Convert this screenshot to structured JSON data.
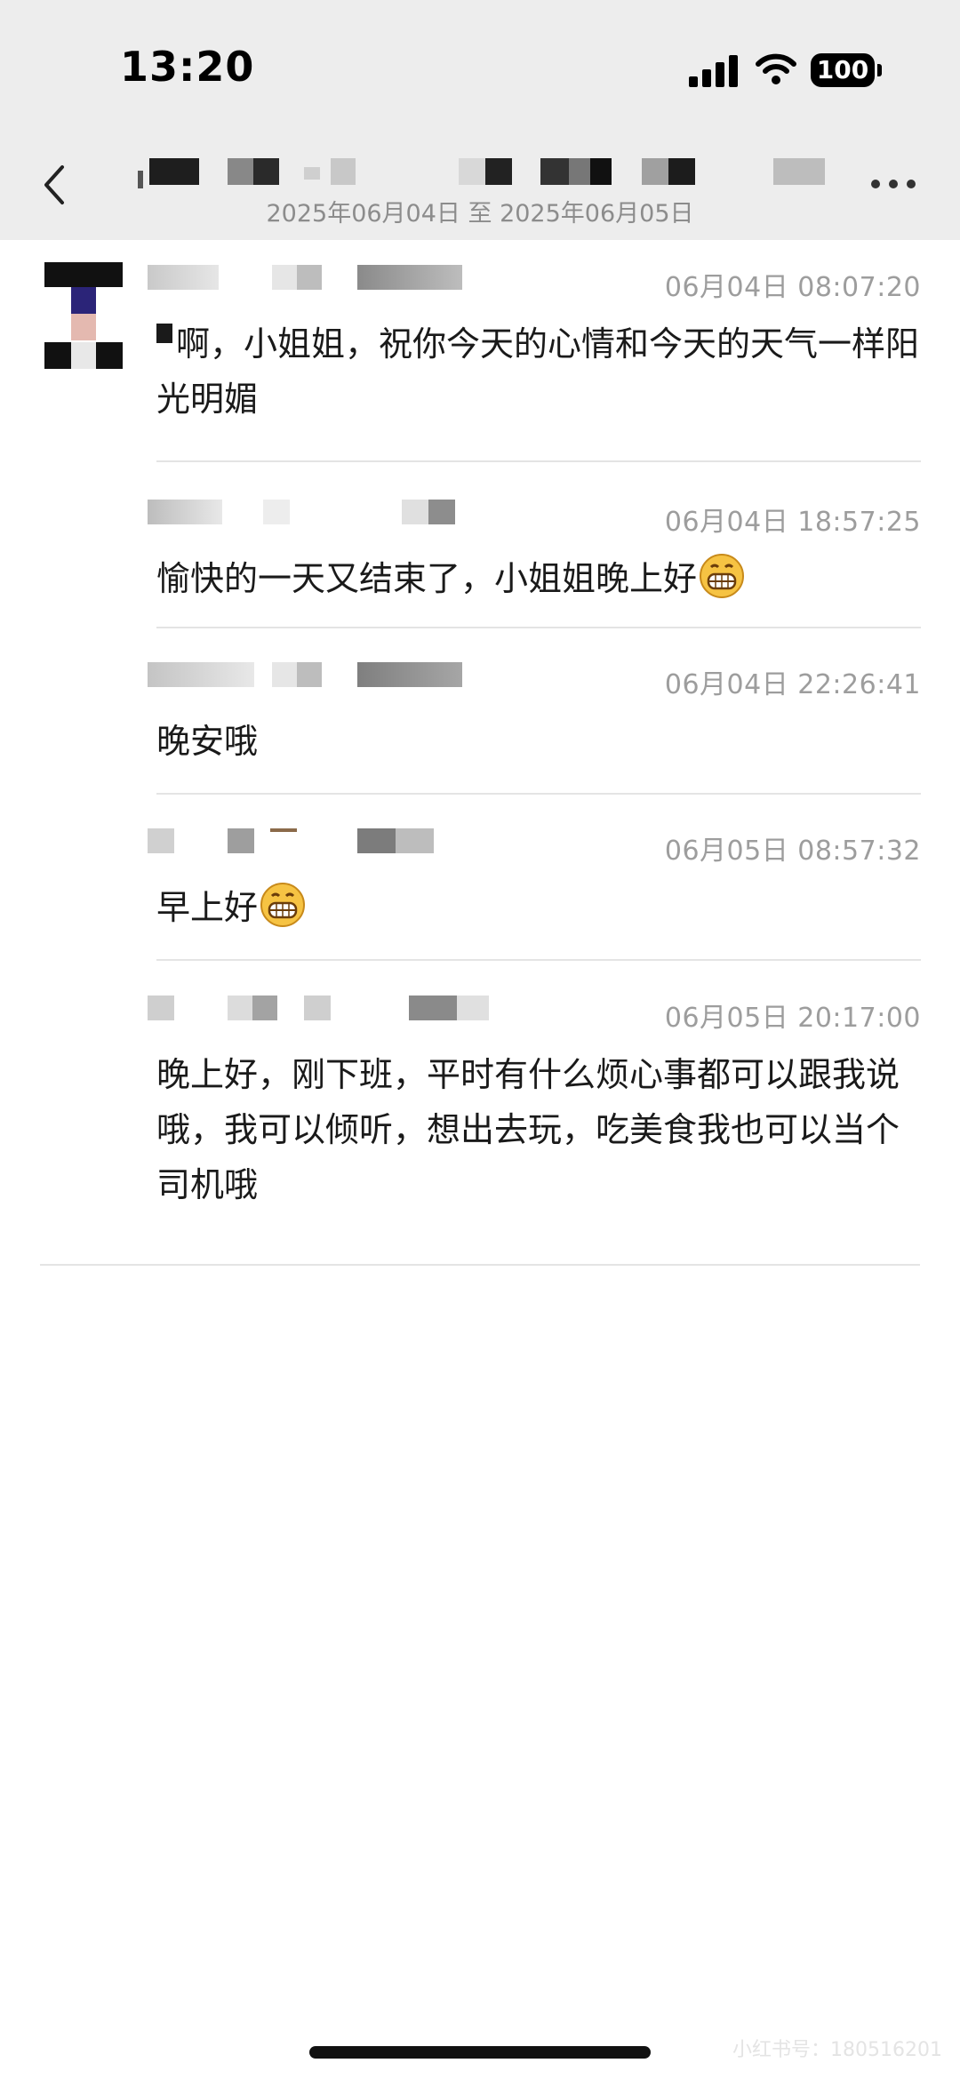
{
  "status_bar": {
    "time": "13:20",
    "battery": "100"
  },
  "header": {
    "date_range": "2025年06月04日 至 2025年06月05日"
  },
  "messages": [
    {
      "timestamp": "06月04日 08:07:20",
      "text": "啊，小姐姐，祝你今天的心情和今天的天气一样阳光明媚",
      "emoji": ""
    },
    {
      "timestamp": "06月04日 18:57:25",
      "text": "愉快的一天又结束了，小姐姐晚上好",
      "emoji": "grinning-face-icon"
    },
    {
      "timestamp": "06月04日 22:26:41",
      "text": "晚安哦",
      "emoji": ""
    },
    {
      "timestamp": "06月05日 08:57:32",
      "text": "早上好",
      "emoji": "grinning-face-icon"
    },
    {
      "timestamp": "06月05日 20:17:00",
      "text": "晚上好，刚下班，平时有什么烦心事都可以跟我说哦，我可以倾听，想出去玩，吃美食我也可以当个司机哦",
      "emoji": ""
    }
  ],
  "watermark": "小红书号：180516201",
  "colors": {
    "header_bg": "#ededed",
    "timestamp": "#9d9d9d",
    "divider": "#e4e4e4",
    "emoji_face": "#f6c343"
  }
}
